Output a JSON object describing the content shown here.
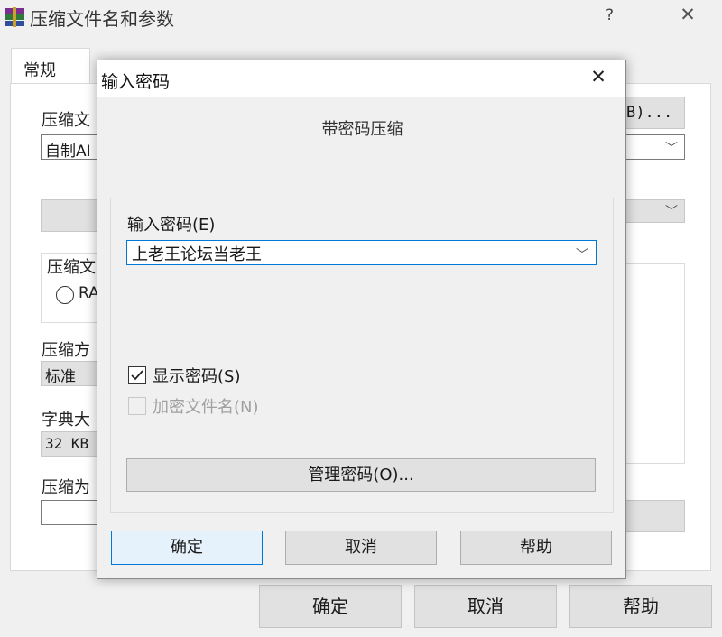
{
  "window": {
    "title": "压缩文件名和参数",
    "help_label": "?",
    "close_label": "✕"
  },
  "tabs": [
    "常规"
  ],
  "behind": {
    "archive_name_label": "压缩文",
    "archive_name_value": "自制AI",
    "browse_button_label": "B)...",
    "format_group_label": "压缩文",
    "format_rar_label": "RA",
    "method_label": "压缩方",
    "method_value": "标准",
    "dict_label": "字典大",
    "dict_value": "32 KB",
    "split_label": "压缩为"
  },
  "main_buttons": {
    "ok": "确定",
    "cancel": "取消",
    "help": "帮助"
  },
  "dialog": {
    "title": "输入密码",
    "close_label": "✕",
    "subtitle": "带密码压缩",
    "password_label": "输入密码(E)",
    "password_value": "上老王论坛当老王",
    "show_password_label": "显示密码(S)",
    "show_password_checked": true,
    "encrypt_names_label": "加密文件名(N)",
    "encrypt_names_checked": false,
    "manage_button_label": "管理密码(O)...",
    "ok_label": "确定",
    "cancel_label": "取消",
    "help_label": "帮助"
  },
  "colors": {
    "accent": "#0078d7",
    "background": "#f0f0f0",
    "button": "#e1e1e1"
  }
}
